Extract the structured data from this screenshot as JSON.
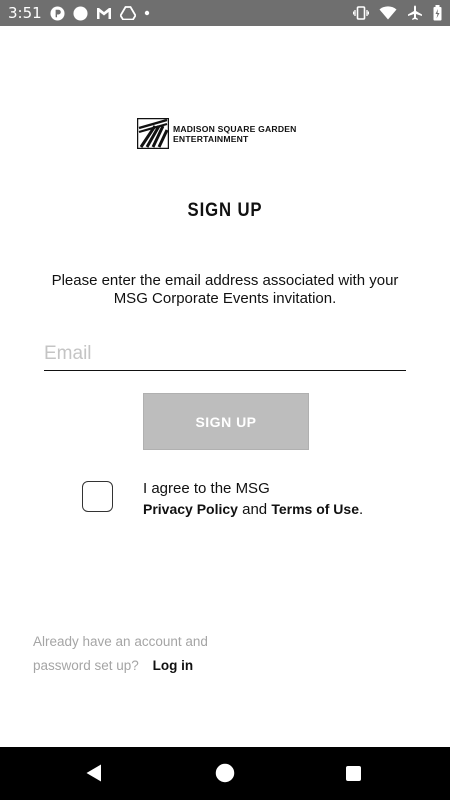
{
  "status_bar": {
    "time": "3:51",
    "icons_left": [
      "app-p-icon",
      "circle-icon",
      "gmail-icon",
      "drive-icon",
      "dot-icon"
    ],
    "icons_right": [
      "vibrate-icon",
      "wifi-icon",
      "airplane-icon",
      "battery-icon"
    ]
  },
  "logo": {
    "line1": "MADISON SQUARE GARDEN",
    "line2": "ENTERTAINMENT"
  },
  "page_title": "SIGN UP",
  "instructions": {
    "line1": "Please enter the email address associated with your",
    "line2": "MSG Corporate Events invitation."
  },
  "email": {
    "placeholder": "Email",
    "value": ""
  },
  "signup_button_label": "SIGN UP",
  "agreement": {
    "checked": false,
    "line1": "I agree to the MSG",
    "privacy_label": "Privacy Policy",
    "and_text": "and",
    "terms_label": "Terms of Use",
    "period": "."
  },
  "account_prompt": {
    "line1": "Already have an account and",
    "line2": "password set up?",
    "login_label": "Log in"
  },
  "nav_bar": {
    "icons": [
      "back-icon",
      "home-icon",
      "recents-icon"
    ]
  },
  "colors": {
    "status_bar": "#6f6f6f",
    "button_disabled": "#bdbdbd",
    "muted_text": "#a5a5a5"
  }
}
